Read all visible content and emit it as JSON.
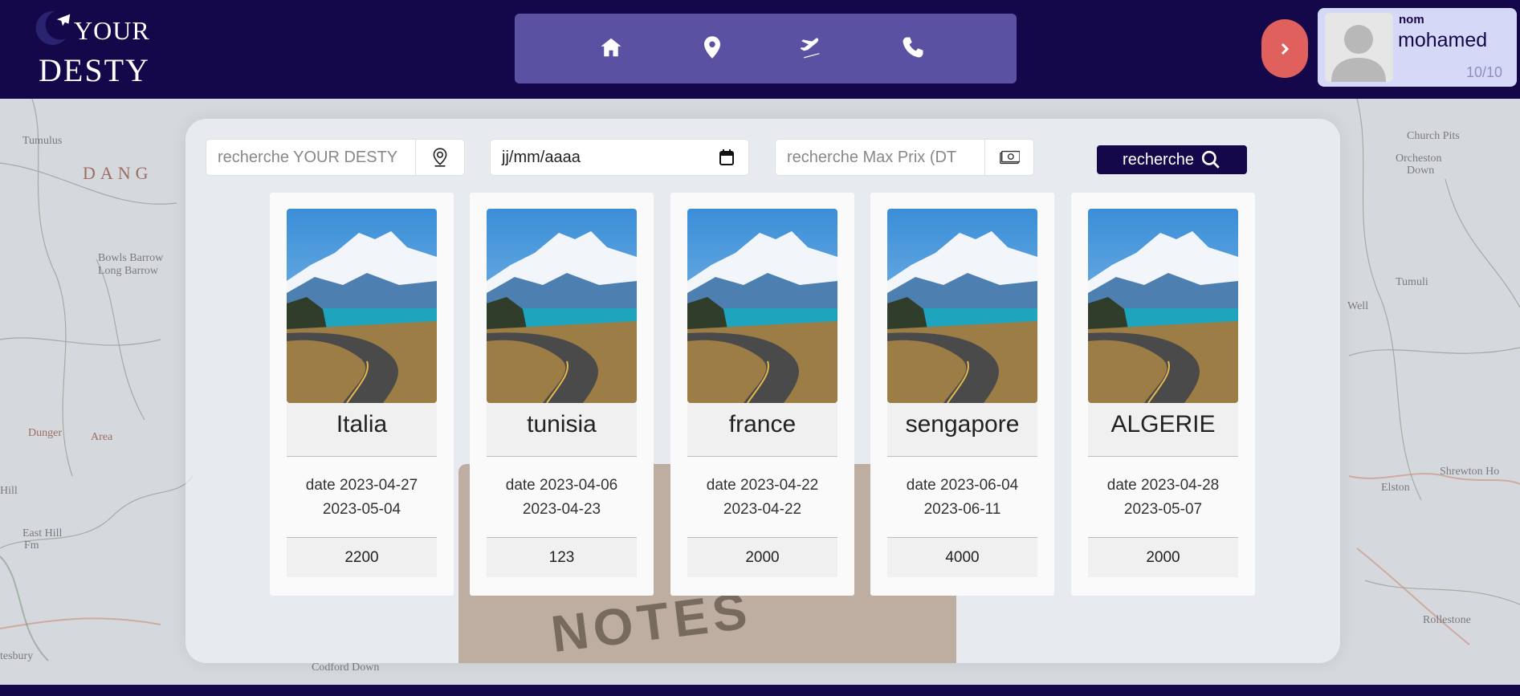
{
  "header": {
    "logo": {
      "line1": "YOUR",
      "line2": "DESTY"
    },
    "nav": [
      {
        "name": "home",
        "icon": "home-icon"
      },
      {
        "name": "location",
        "icon": "map-pin-icon"
      },
      {
        "name": "flights",
        "icon": "airplane-icon"
      },
      {
        "name": "contact",
        "icon": "phone-icon"
      }
    ],
    "arrow_icon": "chevron-right-icon",
    "profile": {
      "label": "nom",
      "name": "mohamed",
      "score": "10/10",
      "avatar_icon": "user-avatar-icon"
    }
  },
  "search": {
    "destination_placeholder": "recherche YOUR DESTY",
    "destination_icon": "location-pin-icon",
    "date_value": "jj/mm/aaaa",
    "date_icon": "calendar-icon",
    "price_placeholder": "recherche Max Prix (DT",
    "price_icon": "money-icon",
    "button_label": "recherche",
    "button_icon": "search-icon"
  },
  "background": {
    "map_labels": [
      "DANG",
      "Dunger",
      "Area",
      "East Hill",
      "Fm",
      "Hill",
      "Bowls Barrow",
      "Long Barrow",
      "tesbury",
      "Codford Down",
      "Orcheston",
      "Down",
      "Church Pits",
      "Elston",
      "Shrewton Ho",
      "Rollestone",
      "Tumulus",
      "Tumuli",
      "Well",
      "NOTES"
    ]
  },
  "colors": {
    "navy": "#15084a",
    "nav_bg": "#5a51a3",
    "accent": "#e0605e",
    "profile_bg": "#d6d8f7"
  },
  "cards": [
    {
      "title": "Italia",
      "date_start": "date 2023-04-27",
      "date_end": "2023-05-04",
      "price": "2200"
    },
    {
      "title": "tunisia",
      "date_start": "date 2023-04-06",
      "date_end": "2023-04-23",
      "price": "123"
    },
    {
      "title": "france",
      "date_start": "date 2023-04-22",
      "date_end": "2023-04-22",
      "price": "2000"
    },
    {
      "title": "sengapore",
      "date_start": "date 2023-06-04",
      "date_end": "2023-06-11",
      "price": "4000"
    },
    {
      "title": "ALGERIE",
      "date_start": "date 2023-04-28",
      "date_end": "2023-05-07",
      "price": "2000"
    }
  ]
}
